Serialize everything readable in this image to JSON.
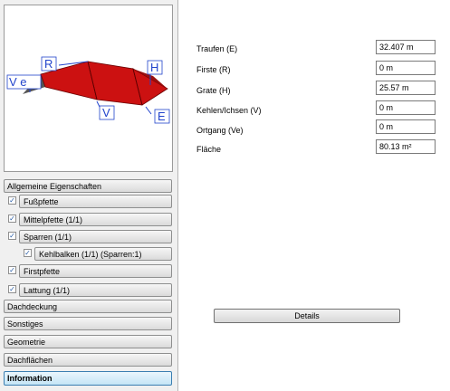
{
  "preview": {
    "labels": {
      "R": "R",
      "Ve": "V e",
      "H": "H",
      "V": "V",
      "E": "E"
    },
    "roof_color": "#cc1111",
    "dimension_color": "#2244cc"
  },
  "sidebar": {
    "items": [
      {
        "label": "Allgemeine Eigenschaften",
        "checked": false
      },
      {
        "label": "Fußpfette",
        "checked": true
      },
      {
        "label": "Mittelpfette (1/1)",
        "checked": true
      },
      {
        "label": "Sparren (1/1)",
        "checked": true
      },
      {
        "label": "Kehlbalken (1/1) (Sparren:1)",
        "checked": true
      },
      {
        "label": "Firstpfette",
        "checked": true
      },
      {
        "label": "Lattung (1/1)",
        "checked": true
      },
      {
        "label": "Dachdeckung"
      },
      {
        "label": "Sonstiges"
      },
      {
        "label": "Geometrie"
      },
      {
        "label": "Dachflächen"
      },
      {
        "label": "Information",
        "active": true
      }
    ],
    "check_mark": "✓"
  },
  "info": {
    "rows": [
      {
        "label": "Traufen (E)",
        "value": "32.407 m"
      },
      {
        "label": "Firste (R)",
        "value": "0 m"
      },
      {
        "label": "Grate (H)",
        "value": "25.57 m"
      },
      {
        "label": "Kehlen/Ichsen (V)",
        "value": "0 m"
      },
      {
        "label": "Ortgang (Ve)",
        "value": "0 m"
      },
      {
        "label": "Fläche",
        "value": "80.13 m²"
      }
    ],
    "details_label": "Details"
  }
}
